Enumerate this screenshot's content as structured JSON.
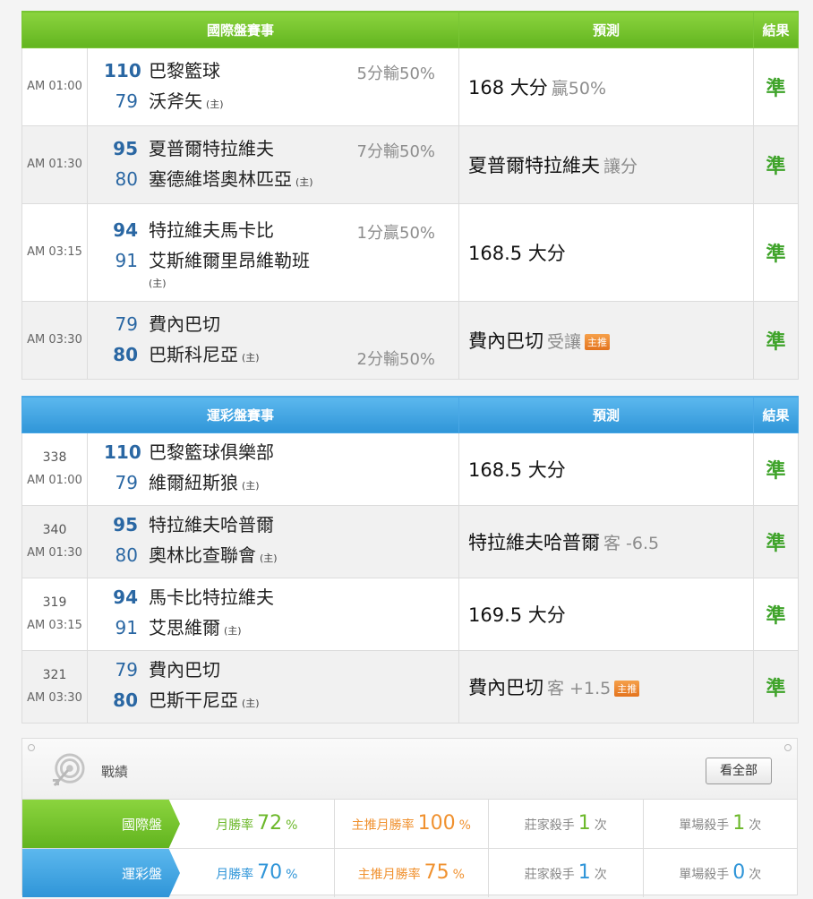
{
  "intl": {
    "header": {
      "match": "國際盤賽事",
      "pred": "預測",
      "result": "結果"
    },
    "rows": [
      {
        "time": "AM 01:00",
        "t1": {
          "score": "110",
          "name": "巴黎籃球",
          "bold": true
        },
        "t2": {
          "score": "79",
          "name": "沃斧矢",
          "bold": false,
          "home": "(主)"
        },
        "handicap": "5分輸50%",
        "hc_pos": "top",
        "pred_main": "168 大分",
        "pred_sub": "贏50%",
        "badge": "",
        "result": "準"
      },
      {
        "time": "AM 01:30",
        "t1": {
          "score": "95",
          "name": "夏普爾特拉維夫",
          "bold": true
        },
        "t2": {
          "score": "80",
          "name": "塞德維塔奧林匹亞",
          "bold": false,
          "home": "(主)"
        },
        "handicap": "7分輸50%",
        "hc_pos": "top",
        "pred_main": "夏普爾特拉維夫",
        "pred_sub": "讓分",
        "badge": "",
        "result": "準"
      },
      {
        "time": "AM 03:15",
        "t1": {
          "score": "94",
          "name": "特拉維夫馬卡比",
          "bold": true
        },
        "t2": {
          "score": "91",
          "name": "艾斯維爾里昂維勒班",
          "bold": false,
          "home": "(主)"
        },
        "handicap": "1分贏50%",
        "hc_pos": "top",
        "pred_main": "168.5 大分",
        "pred_sub": "",
        "badge": "",
        "result": "準"
      },
      {
        "time": "AM 03:30",
        "t1": {
          "score": "79",
          "name": "費內巴切",
          "bold": false
        },
        "t2": {
          "score": "80",
          "name": "巴斯科尼亞",
          "bold": true,
          "home": "(主)"
        },
        "handicap": "2分輸50%",
        "hc_pos": "bottom",
        "pred_main": "費內巴切",
        "pred_sub": "受讓",
        "badge": "主推",
        "result": "準"
      }
    ]
  },
  "lottery": {
    "header": {
      "match": "運彩盤賽事",
      "pred": "預測",
      "result": "結果"
    },
    "rows": [
      {
        "num": "338",
        "time": "AM 01:00",
        "t1": {
          "score": "110",
          "name": "巴黎籃球俱樂部",
          "bold": true
        },
        "t2": {
          "score": "79",
          "name": "維爾紐斯狼",
          "bold": false,
          "home": "(主)"
        },
        "pred_main": "168.5 大分",
        "pred_sub": "",
        "badge": "",
        "result": "準"
      },
      {
        "num": "340",
        "time": "AM 01:30",
        "t1": {
          "score": "95",
          "name": "特拉維夫哈普爾",
          "bold": true
        },
        "t2": {
          "score": "80",
          "name": "奧林比查聯會",
          "bold": false,
          "home": "(主)"
        },
        "pred_main": "特拉維夫哈普爾",
        "pred_sub": "客 -6.5",
        "badge": "",
        "result": "準"
      },
      {
        "num": "319",
        "time": "AM 03:15",
        "t1": {
          "score": "94",
          "name": "馬卡比特拉維夫",
          "bold": true
        },
        "t2": {
          "score": "91",
          "name": "艾思維爾",
          "bold": false,
          "home": "(主)"
        },
        "pred_main": "169.5 大分",
        "pred_sub": "",
        "badge": "",
        "result": "準"
      },
      {
        "num": "321",
        "time": "AM 03:30",
        "t1": {
          "score": "79",
          "name": "費內巴切",
          "bold": false
        },
        "t2": {
          "score": "80",
          "name": "巴斯干尼亞",
          "bold": true,
          "home": "(主)"
        },
        "pred_main": "費內巴切",
        "pred_sub": "客 +1.5",
        "badge": "主推",
        "result": "準"
      }
    ]
  },
  "stats": {
    "title": "戰績",
    "view_all": "看全部",
    "rows": [
      {
        "tag": "國際盤",
        "color": "green",
        "month_label": "月勝率",
        "month_val": "72",
        "main_label": "主推月勝率",
        "main_val": "100",
        "pct": "%",
        "banker_label": "莊家殺手",
        "banker_val": "1",
        "single_label": "單場殺手",
        "single_val": "1",
        "times": "次"
      },
      {
        "tag": "運彩盤",
        "color": "blue",
        "month_label": "月勝率",
        "month_val": "70",
        "main_label": "主推月勝率",
        "main_val": "75",
        "pct": "%",
        "banker_label": "莊家殺手",
        "banker_val": "1",
        "single_label": "單場殺手",
        "single_val": "0",
        "times": "次"
      }
    ]
  }
}
